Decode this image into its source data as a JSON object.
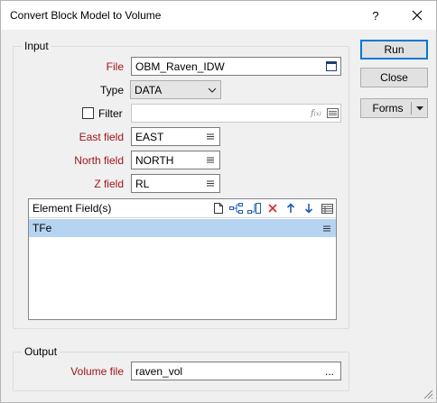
{
  "window": {
    "title": "Convert Block Model to Volume",
    "help_label": "?"
  },
  "input": {
    "legend": "Input",
    "file_label": "File",
    "file_value": "OBM_Raven_IDW",
    "type_label": "Type",
    "type_value": "DATA",
    "filter_label": "Filter",
    "filter_value": "",
    "east_label": "East field",
    "east_value": "EAST",
    "north_label": "North field",
    "north_value": "NORTH",
    "z_label": "Z field",
    "z_value": "RL",
    "element_header": "Element Field(s)",
    "element_rows": [
      "TFe"
    ]
  },
  "output": {
    "legend": "Output",
    "volume_label": "Volume file",
    "volume_value": "raven_vol",
    "browse_label": "..."
  },
  "buttons": {
    "run": "Run",
    "close": "Close",
    "forms": "Forms"
  },
  "colors": {
    "required_label": "#a0131a",
    "selection": "#b6d4f2",
    "delete_icon": "#d42a2a",
    "arrow_icon": "#1a5fb4"
  }
}
